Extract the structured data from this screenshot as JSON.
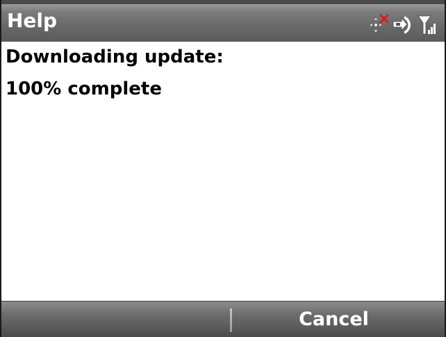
{
  "titlebar": {
    "title": "Help",
    "icons": [
      "navigation-move-icon",
      "error-x-icon",
      "data-connection-icon",
      "signal-strength-icon"
    ]
  },
  "content": {
    "line1": "Downloading update:",
    "line2": "100% complete",
    "progress_percent": 100
  },
  "softkeys": {
    "left_label": "",
    "right_label": "Cancel"
  },
  "colors": {
    "bar_dark": "#5a5a5a",
    "bar_light": "#9a9a9a",
    "error_red": "#e0191e",
    "text": "#000000",
    "background": "#ffffff"
  }
}
